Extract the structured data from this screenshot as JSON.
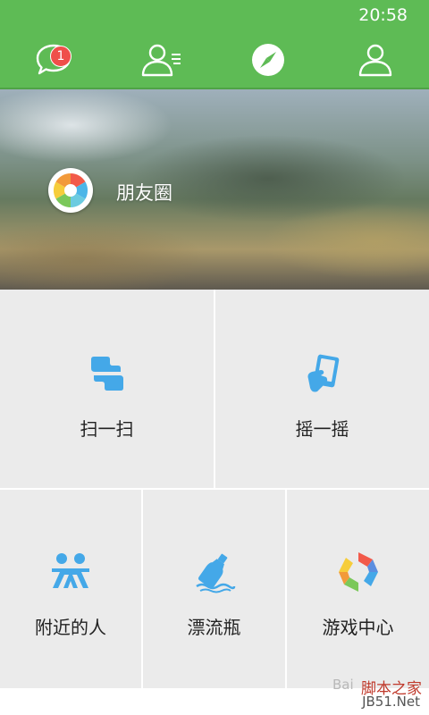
{
  "status_bar": {
    "time": "20:58"
  },
  "nav": {
    "tabs": [
      {
        "icon": "chat-bubble-icon",
        "badge": "1"
      },
      {
        "icon": "contacts-icon"
      },
      {
        "icon": "compass-icon",
        "active": true
      },
      {
        "icon": "profile-icon"
      }
    ]
  },
  "banner": {
    "label": "朋友圈"
  },
  "features": {
    "scan": "扫一扫",
    "shake": "摇一摇",
    "nearby": "附近的人",
    "bottle": "漂流瓶",
    "games": "游戏中心"
  },
  "watermark": {
    "site_cn": "脚本之家",
    "site_en": "JB51.Net",
    "baidu": "Bai"
  },
  "colors": {
    "nav_green": "#5ebb55",
    "accent_blue": "#44a8e8",
    "badge_red": "#ef4f4a"
  }
}
